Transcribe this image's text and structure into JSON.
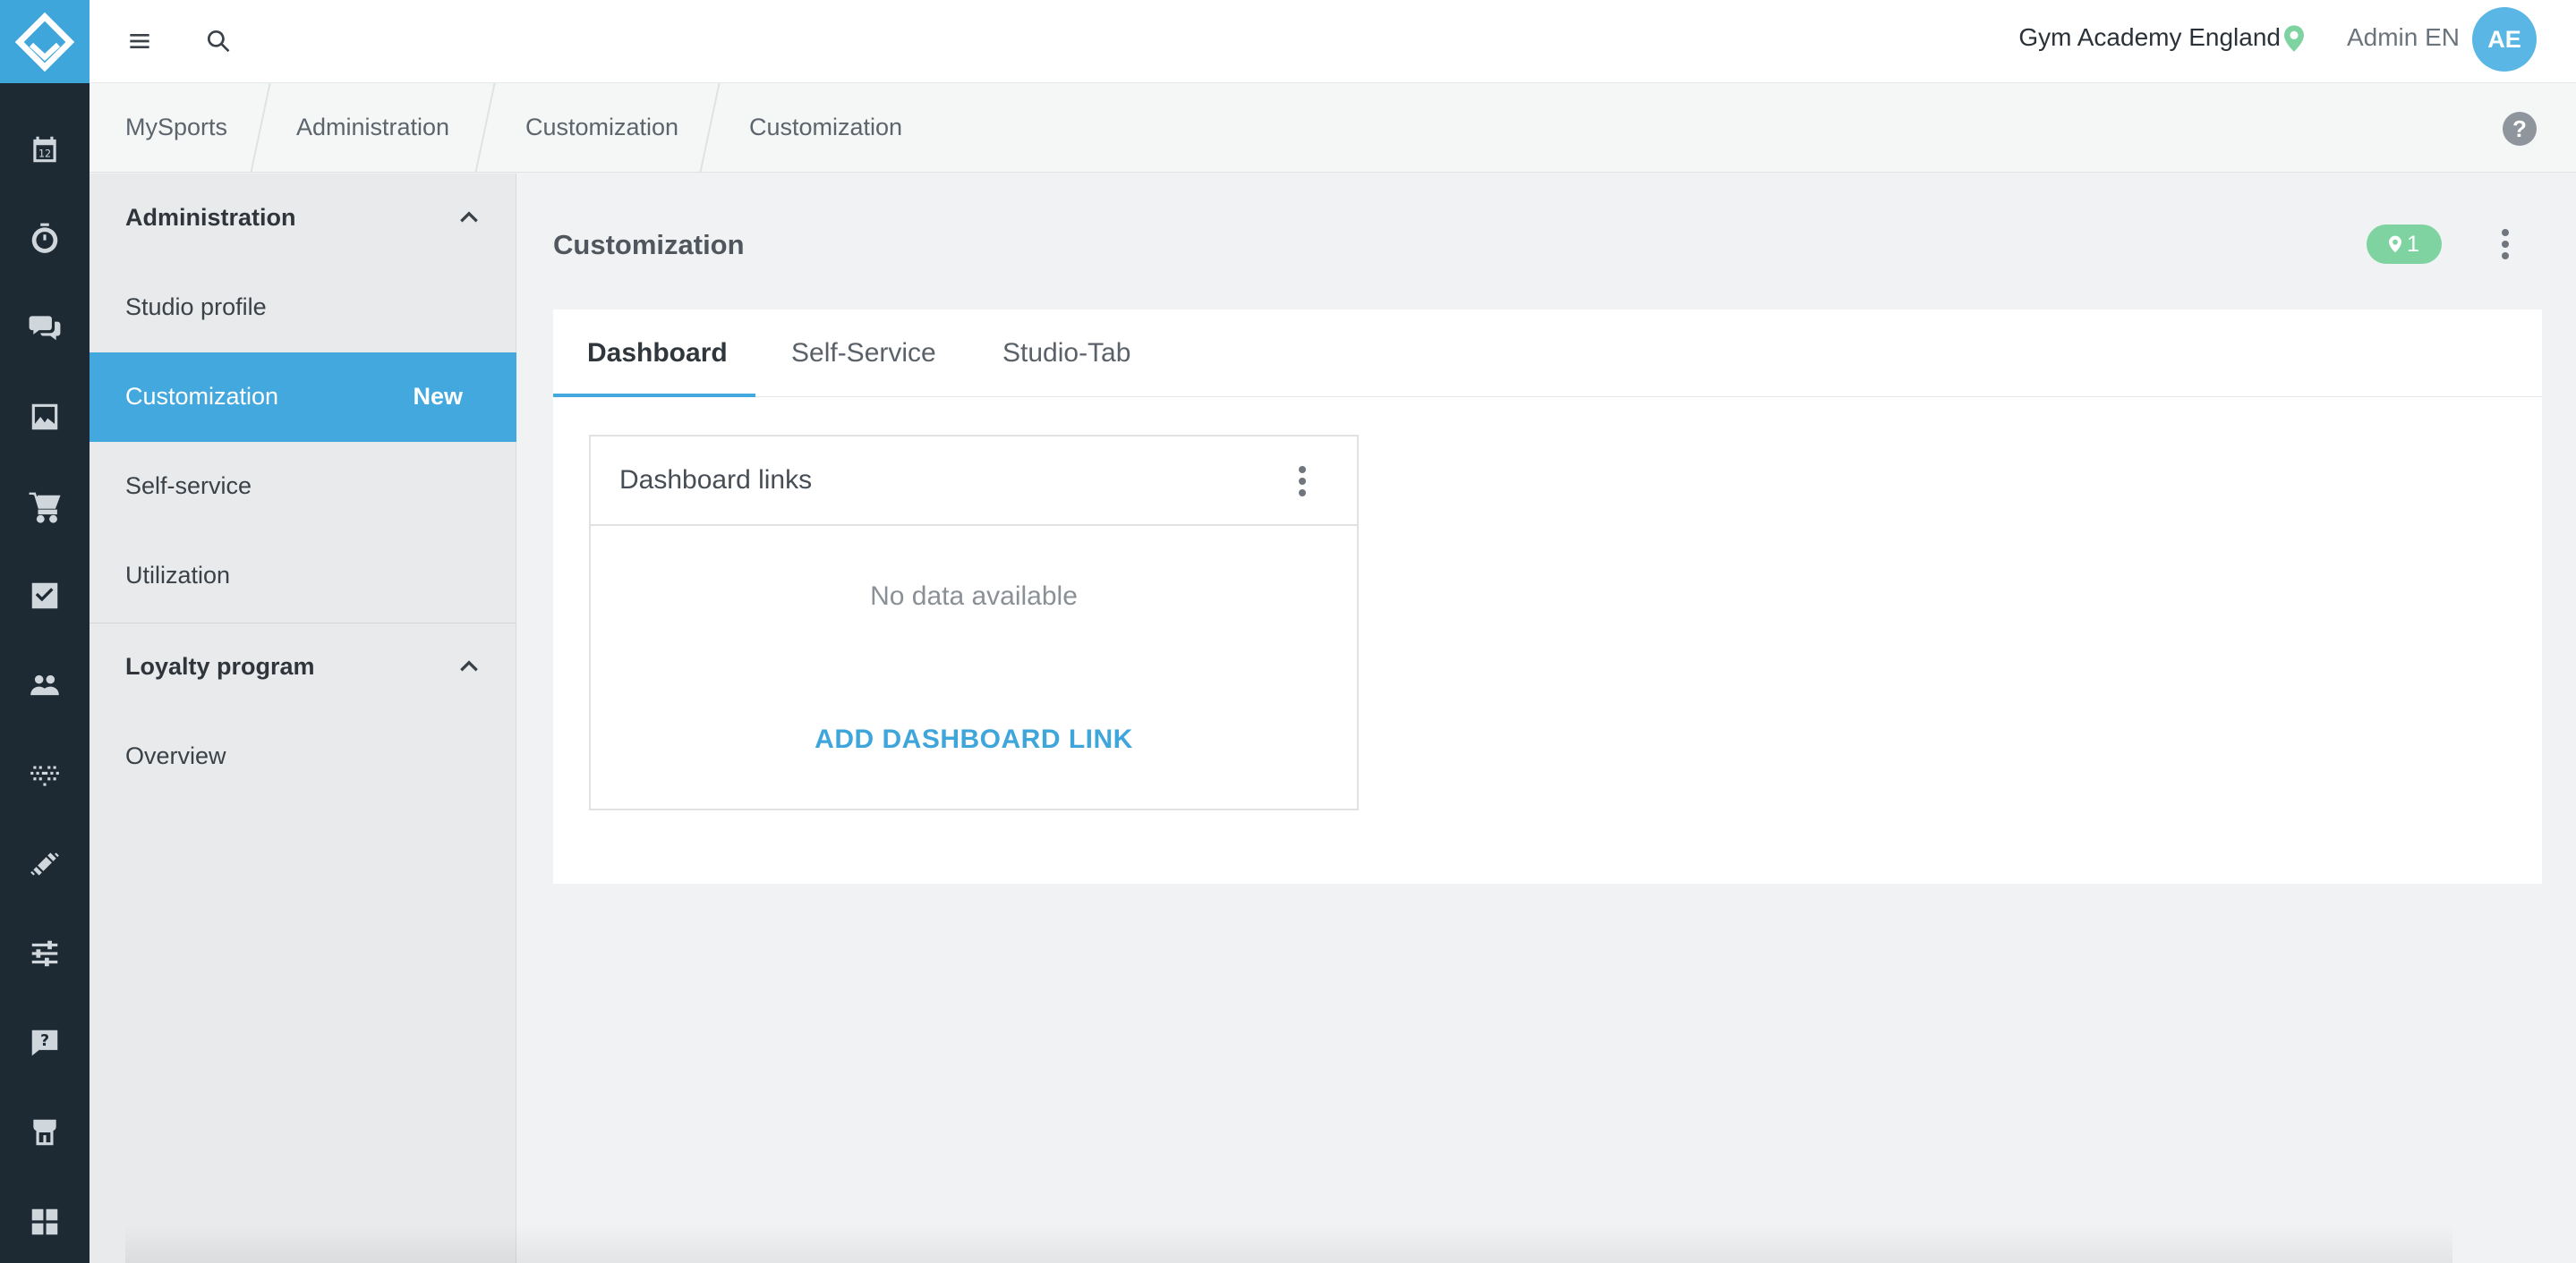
{
  "rail": {
    "icons": [
      "calendar-icon",
      "stopwatch-icon",
      "chat-icon",
      "image-icon",
      "cart-icon",
      "checkbox-icon",
      "group-icon",
      "heart-rate-icon",
      "dumbbell-icon",
      "sliders-icon",
      "help-chat-icon",
      "store-icon",
      "grid-icon"
    ],
    "calendar_day": "12"
  },
  "topbar": {
    "studio_name": "Gym Academy England",
    "admin_name": "Admin EN",
    "avatar_initials": "AE"
  },
  "breadcrumb": [
    "MySports",
    "Administration",
    "Customization",
    "Customization"
  ],
  "help_symbol": "?",
  "sidebar": {
    "sections": [
      {
        "heading": "Administration",
        "items": [
          {
            "label": "Studio profile"
          },
          {
            "label": "Customization",
            "badge": "New",
            "active": true
          },
          {
            "label": "Self-service"
          },
          {
            "label": "Utilization"
          }
        ]
      },
      {
        "heading": "Loyalty program",
        "items": [
          {
            "label": "Overview"
          }
        ]
      }
    ]
  },
  "main": {
    "title": "Customization",
    "location_count": "1",
    "tabs": [
      {
        "label": "Dashboard",
        "active": true
      },
      {
        "label": "Self-Service"
      },
      {
        "label": "Studio-Tab"
      }
    ],
    "card": {
      "title": "Dashboard links",
      "empty_text": "No data available",
      "action_label": "ADD DASHBOARD LINK"
    }
  },
  "colors": {
    "accent": "#43a8de",
    "rail": "#1e2a33",
    "location_badge": "#7fd3a1"
  }
}
